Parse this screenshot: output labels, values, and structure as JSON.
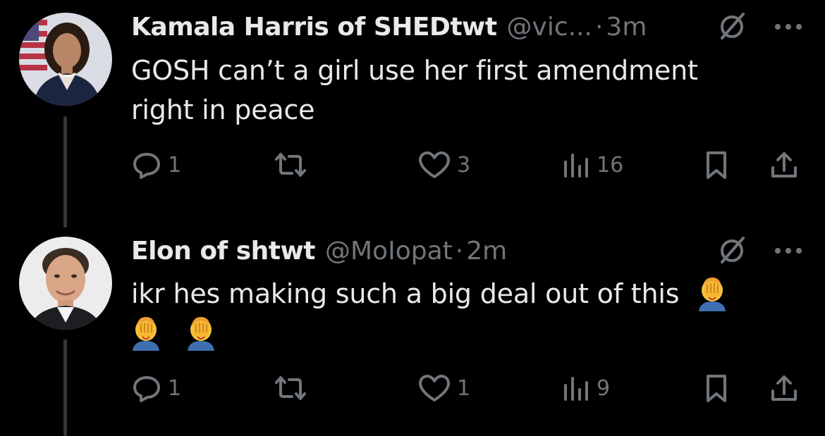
{
  "colors": {
    "background": "#000000",
    "text_primary": "#e7e9ea",
    "text_secondary": "#71767b",
    "thread_line": "#333639"
  },
  "tweets": [
    {
      "display_name": "Kamala Harris of SHEDtwt",
      "handle": "@vic...",
      "separator": "·",
      "time": "3m",
      "text": "GOSH can’t a girl use her first amendment right in peace",
      "replies": "1",
      "reposts": "",
      "likes": "3",
      "views": "16",
      "icons": [
        "reply-icon",
        "repost-icon",
        "like-icon",
        "views-icon",
        "bookmark-icon",
        "share-icon",
        "grok-icon",
        "more-icon"
      ]
    },
    {
      "display_name": "Elon of shtwt",
      "handle": "@MoIopat",
      "separator": "·",
      "time": "2m",
      "text": "ikr hes making such a big deal out of this",
      "emoji_count": 3,
      "emoji": "face-palm-emoji",
      "replies": "1",
      "reposts": "",
      "likes": "1",
      "views": "9",
      "icons": [
        "reply-icon",
        "repost-icon",
        "like-icon",
        "views-icon",
        "bookmark-icon",
        "share-icon",
        "grok-icon",
        "more-icon"
      ]
    }
  ]
}
